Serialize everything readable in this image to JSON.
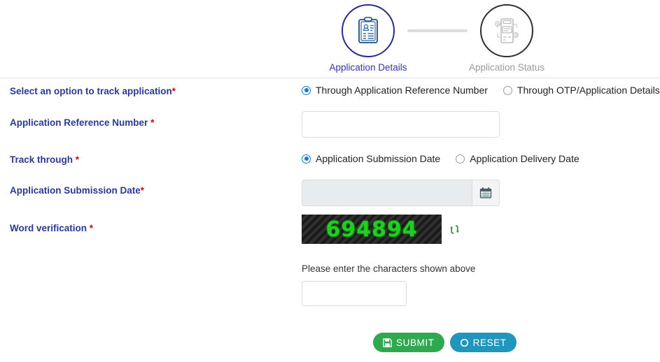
{
  "stepper": {
    "steps": [
      {
        "label": "Application Details",
        "state": "active",
        "icon": "clipboard-person-icon"
      },
      {
        "label": "Application Status",
        "state": "inactive",
        "icon": "document-gears-icon"
      }
    ]
  },
  "form": {
    "track_option": {
      "label": "Select an option to track application",
      "required": "*",
      "options": [
        {
          "text": "Through Application Reference Number",
          "selected": true
        },
        {
          "text": "Through OTP/Application Details",
          "selected": false
        }
      ]
    },
    "reference_number": {
      "label": "Application Reference Number",
      "required": "*",
      "value": "",
      "placeholder": ""
    },
    "track_through": {
      "label": "Track through",
      "required": "*",
      "options": [
        {
          "text": "Application Submission Date",
          "selected": true
        },
        {
          "text": "Application Delivery Date",
          "selected": false
        }
      ]
    },
    "submission_date": {
      "label": "Application Submission Date",
      "required": "*",
      "value": "",
      "placeholder": "",
      "calendar_icon": "calendar-icon"
    },
    "word_verification": {
      "label": "Word verification",
      "required": "*",
      "captcha_text": "694894",
      "refresh_icon": "refresh-icon",
      "hint": "Please enter the characters shown above",
      "value": "",
      "placeholder": ""
    }
  },
  "buttons": {
    "submit": {
      "label": "SUBMIT",
      "icon": "save-icon"
    },
    "reset": {
      "label": "RESET",
      "icon": "power-icon"
    }
  },
  "colors": {
    "label_blue": "#2b3990",
    "required_red": "#d0021b",
    "step_active": "#3333aa",
    "step_inactive": "#9b9b9b",
    "submit_green": "#2fa84f",
    "reset_blue": "#2196bd",
    "captcha_green": "#22cc22"
  }
}
